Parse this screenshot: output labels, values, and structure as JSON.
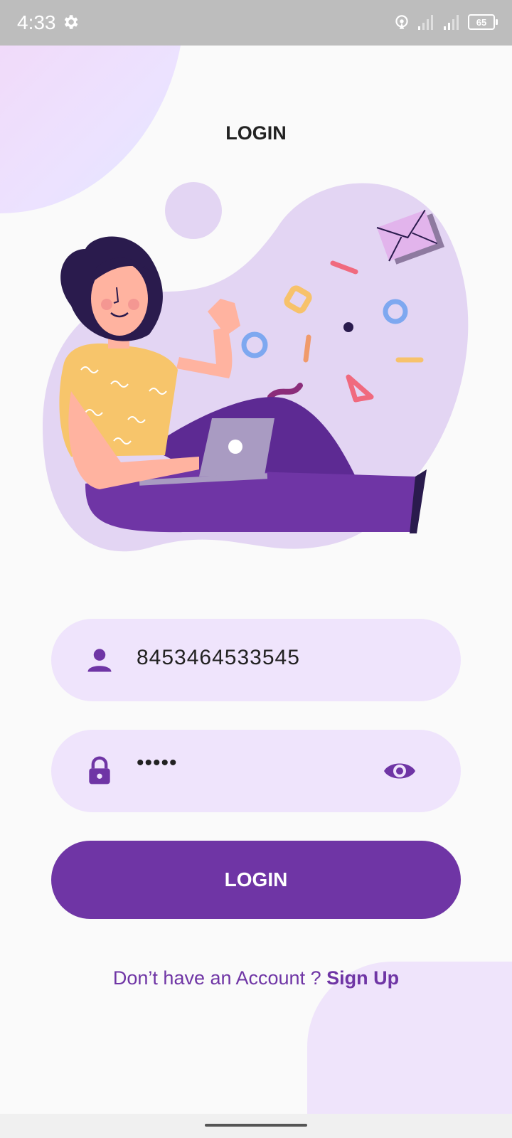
{
  "status_bar": {
    "time": "4:33",
    "battery": "65",
    "icons": [
      "gear-icon",
      "hotspot-icon",
      "signal-icon",
      "signal-icon",
      "battery-icon"
    ]
  },
  "page": {
    "title": "LOGIN"
  },
  "form": {
    "username": {
      "value": "8453464533545",
      "icon": "person-icon"
    },
    "password": {
      "value": "•••••",
      "icon": "lock-icon",
      "toggle_icon": "eye-icon"
    },
    "login_button": "LOGIN"
  },
  "signup": {
    "prompt": "Don’t have an Account ? ",
    "link": "Sign Up"
  },
  "colors": {
    "primary": "#6F35A5",
    "field_bg": "#EFE4FC",
    "background": "#FAFAFA"
  }
}
